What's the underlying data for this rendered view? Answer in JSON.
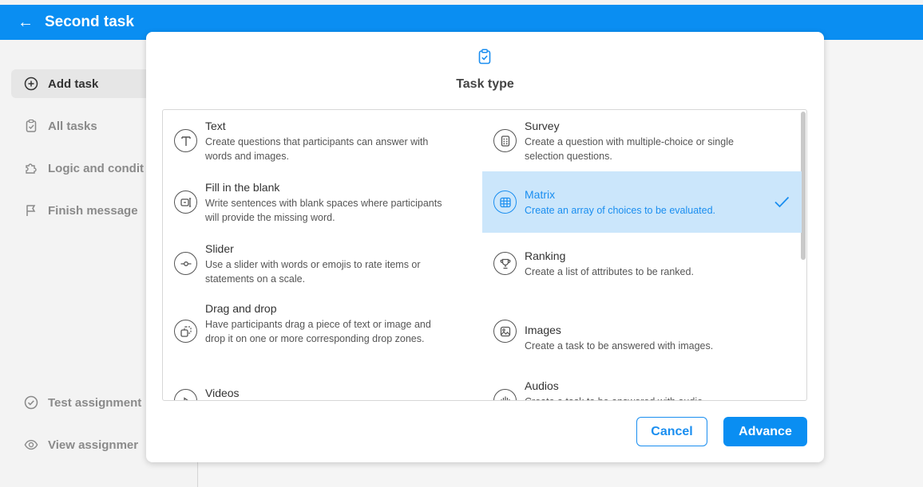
{
  "header": {
    "back_icon": "arrow-left-icon",
    "title": "Second task"
  },
  "sidebar": {
    "items": [
      {
        "label": "Add task",
        "icon": "plus-circle-icon",
        "active": true
      },
      {
        "label": "All tasks",
        "icon": "clipboard-check-icon",
        "active": false
      },
      {
        "label": "Logic and condit",
        "icon": "puzzle-icon",
        "active": false
      },
      {
        "label": "Finish message",
        "icon": "flag-icon",
        "active": false
      },
      {
        "label": "Test assignment",
        "icon": "check-circle-icon",
        "active": false
      },
      {
        "label": "View assignmer",
        "icon": "eye-icon",
        "active": false
      }
    ]
  },
  "modal": {
    "icon": "clipboard-check-icon",
    "title": "Task type",
    "options": [
      {
        "name": "Text",
        "desc": "Create questions that participants can answer with words and images.",
        "icon": "text-icon"
      },
      {
        "name": "Survey",
        "desc": "Create a question with multiple-choice or single selection questions.",
        "icon": "survey-icon"
      },
      {
        "name": "Fill in the blank",
        "desc": "Write sentences with blank spaces where participants will provide the missing word.",
        "icon": "fill-blank-icon"
      },
      {
        "name": "Matrix",
        "desc": "Create an array of choices to be evaluated.",
        "icon": "matrix-icon",
        "selected": true
      },
      {
        "name": "Slider",
        "desc": "Use a slider with words or emojis to rate items or statements on a scale.",
        "icon": "slider-icon"
      },
      {
        "name": "Ranking",
        "desc": "Create a list of attributes to be ranked.",
        "icon": "trophy-icon"
      },
      {
        "name": "Drag and drop",
        "desc": "Have participants drag a piece of text or image and drop it on one or more corresponding drop zones.",
        "icon": "drag-drop-icon"
      },
      {
        "name": "Images",
        "desc": "Create a task to be answered with images.",
        "icon": "image-icon"
      },
      {
        "name": "Videos",
        "desc": "",
        "icon": "video-icon"
      },
      {
        "name": "Audios",
        "desc": "Create a task to be answered with audio.",
        "icon": "audio-icon"
      }
    ],
    "cancel_label": "Cancel",
    "advance_label": "Advance"
  },
  "colors": {
    "accent": "#0a8ef2",
    "selected_bg": "#cbe6fb",
    "selected_text": "#1a8ef0"
  }
}
